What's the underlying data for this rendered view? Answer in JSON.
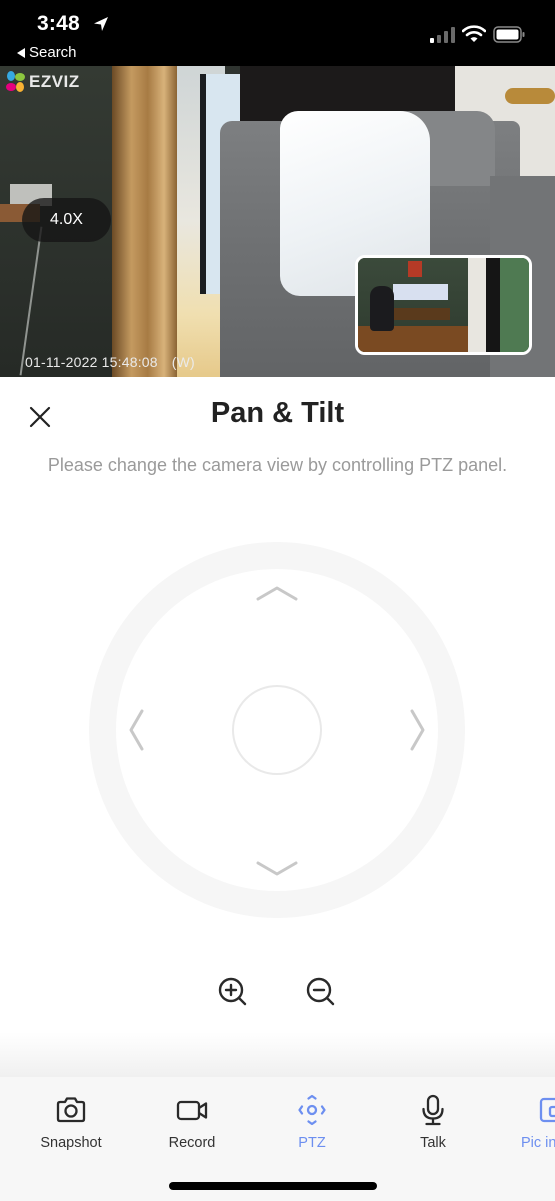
{
  "status_bar": {
    "time": "3:48",
    "back_label": "Search",
    "icons": [
      "location-arrow-icon",
      "cellular-signal-icon",
      "wifi-icon",
      "battery-icon"
    ]
  },
  "video": {
    "brand": "EZVIZ",
    "zoom_level": "4.0X",
    "timestamp": "01-11-2022 15:48:08",
    "mode": "(W)"
  },
  "panel": {
    "title": "Pan & Tilt",
    "description": "Please change the camera view by controlling PTZ panel.",
    "close_icon": "close-icon",
    "controls": [
      "up",
      "down",
      "left",
      "right",
      "center"
    ],
    "zoom_buttons": [
      "zoom-in-icon",
      "zoom-out-icon"
    ]
  },
  "toolbar": {
    "active_color": "#6d8ff0",
    "items": [
      {
        "label": "Snapshot",
        "icon": "camera-icon",
        "active": false
      },
      {
        "label": "Record",
        "icon": "video-camera-icon",
        "active": false
      },
      {
        "label": "PTZ",
        "icon": "ptz-icon",
        "active": true
      },
      {
        "label": "Talk",
        "icon": "microphone-icon",
        "active": false
      },
      {
        "label": "Pic in",
        "icon": "picture-in-picture-icon",
        "active": true
      }
    ]
  }
}
